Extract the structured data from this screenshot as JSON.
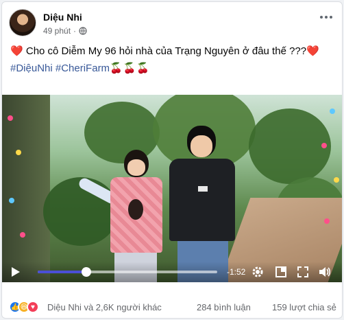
{
  "post": {
    "author": "Diệu Nhi",
    "time": "49 phút",
    "caption_text": "Cho cô Diễm My 96 hỏi nhà của Trạng Nguyên ở đâu thế ???",
    "hashtags": [
      "#DiệuNhi",
      "#CheriFarm"
    ],
    "cherries": "🍒🍒🍒"
  },
  "video": {
    "time_remaining": "-1:52",
    "progress": 0.27
  },
  "footer": {
    "reactors": "Diệu Nhi và 2,6K người khác",
    "comments": "284 bình luận",
    "shares": "159 lượt chia sẻ"
  },
  "colors": {
    "link": "#385898",
    "progress": "#4b4fd6",
    "like": "#1877f2",
    "love": "#f33e58"
  }
}
